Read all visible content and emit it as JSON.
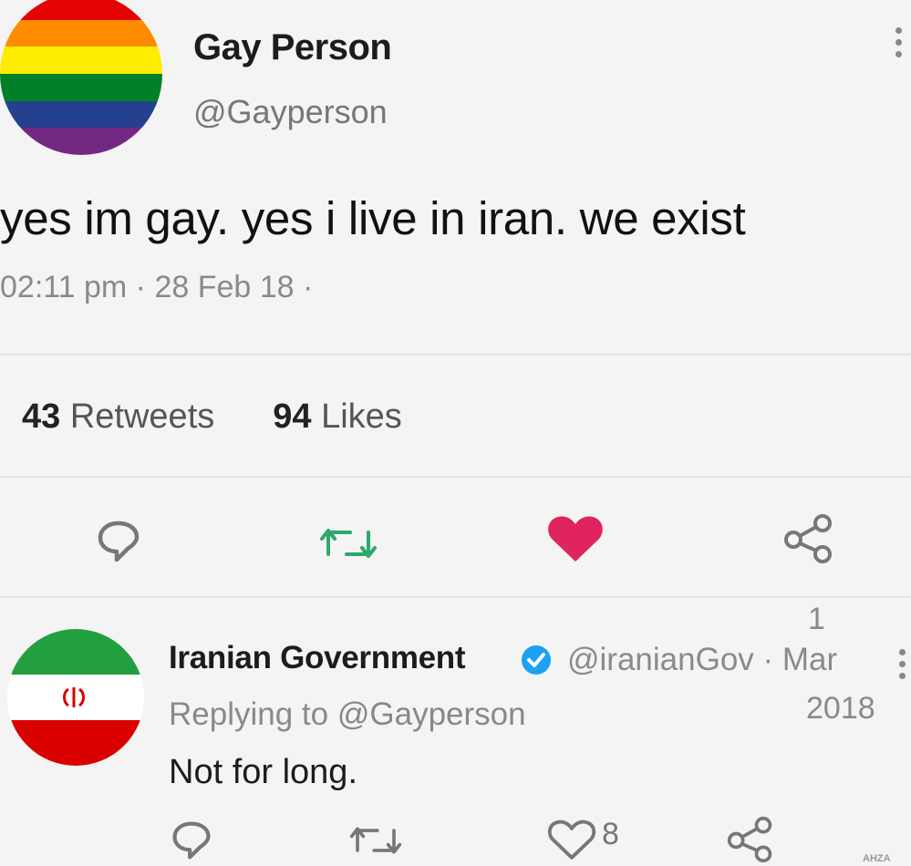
{
  "main_tweet": {
    "display_name": "Gay Person",
    "handle": "@Gayperson",
    "avatar_icon": "rainbow-flag-avatar",
    "avatar_colors": [
      "#e40303",
      "#ff8c00",
      "#ffed00",
      "#008026",
      "#24408e",
      "#732982"
    ],
    "text": "yes im gay. yes i live in iran. we exist",
    "timestamp": "02:11 pm · 28 Feb 18 ·",
    "retweets_count": "43",
    "retweets_label": "Retweets",
    "likes_count": "94",
    "likes_label": "Likes",
    "actions": [
      "reply-icon",
      "retweet-icon",
      "like-icon",
      "share-icon"
    ],
    "retweet_color": "#2ea86b",
    "liked_color": "#e0245e"
  },
  "reply_tweet": {
    "display_name": "Iranian Government",
    "verified": true,
    "verified_color": "#1da1f2",
    "handle_and_date": "@iranianGov · Mar",
    "date_day": "1",
    "date_year": "2018",
    "replying_prefix": "Replying to",
    "replying_to": "@Gayperson",
    "text": "Not for long.",
    "avatar_icon": "iran-flag-avatar",
    "like_count": "8",
    "actions": [
      "reply-icon",
      "retweet-icon",
      "like-icon",
      "share-icon"
    ]
  },
  "watermark": "AHZA"
}
